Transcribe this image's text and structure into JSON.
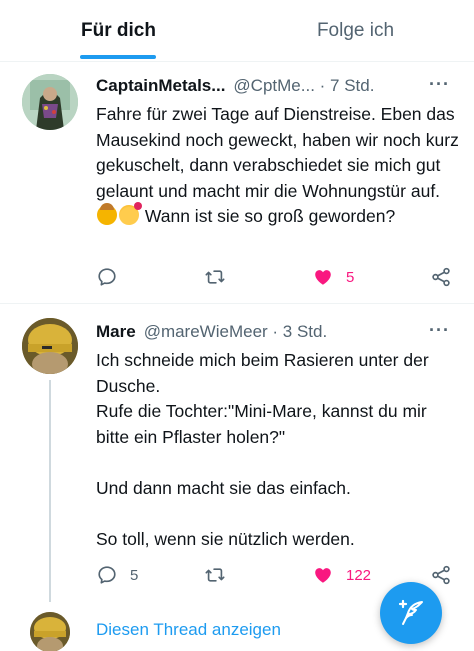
{
  "tabs": [
    {
      "label": "Für dich",
      "active": true
    },
    {
      "label": "Folge ich",
      "active": false
    }
  ],
  "tweets": [
    {
      "name": "CaptainMetals...",
      "handle": "@CptMe... · 7 Std.",
      "text_parts": [
        "Fahre für zwei Tage auf Dienstreise. Eben das Mausekind noch geweckt, haben wir noch kurz gekuschelt, dann verabschiedet sie mich gut gelaunt und macht mir die Wohnungstür auf.",
        "Wann ist sie so groß geworden?"
      ],
      "reply_count": "",
      "retweet_count": "",
      "like_count": "5",
      "liked": true
    },
    {
      "name": "Mare",
      "handle": "@mareWieMeer · 3 Std.",
      "paragraphs": [
        "Ich schneide mich beim Rasieren unter der Dusche.",
        "Rufe die Tochter:\"Mini-Mare, kannst du mir bitte ein Pflaster holen?\"",
        "Und dann macht sie das einfach.",
        "So toll, wenn sie nützlich werden."
      ],
      "reply_count": "5",
      "retweet_count": "",
      "like_count": "122",
      "liked": true
    }
  ],
  "show_thread": {
    "label": "Diesen Thread anzeigen"
  },
  "more_label": "···",
  "icons": {
    "reply": "reply-icon",
    "retweet": "retweet-icon",
    "like": "heart-icon",
    "share": "share-icon",
    "compose": "compose-feather-icon"
  },
  "colors": {
    "accent": "#1d9bf0",
    "like": "#f91880",
    "muted": "#536471",
    "text": "#0f1419"
  }
}
